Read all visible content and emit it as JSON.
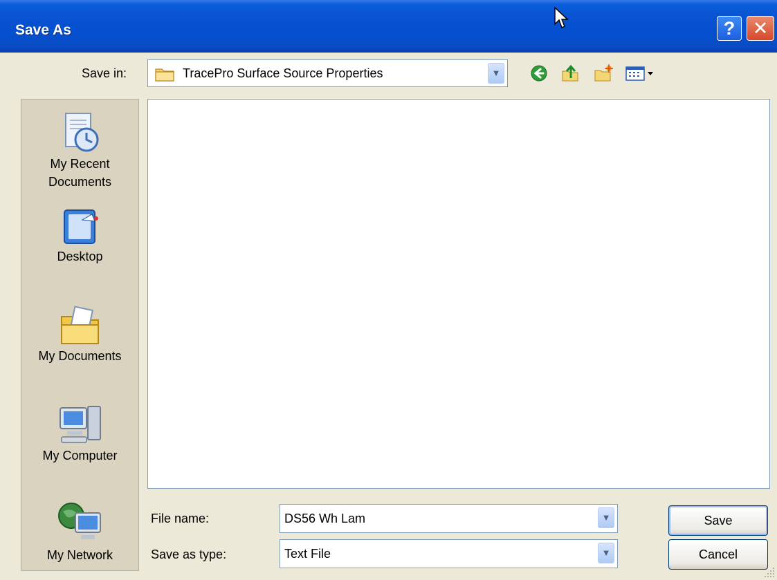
{
  "window": {
    "title": "Save As",
    "help_label": "?",
    "close_label": "✕"
  },
  "toolbar": {
    "save_in_label": "Save in:",
    "save_in_value": "TracePro Surface Source Properties",
    "icons": [
      "back-icon",
      "up-folder-icon",
      "new-folder-icon",
      "views-menu-icon"
    ]
  },
  "places": [
    {
      "label_line1": "My Recent",
      "label_line2": "Documents",
      "icon": "recent-documents-icon"
    },
    {
      "label_line1": "Desktop",
      "label_line2": "",
      "icon": "desktop-icon"
    },
    {
      "label_line1": "My Documents",
      "label_line2": "",
      "icon": "my-documents-icon"
    },
    {
      "label_line1": "My Computer",
      "label_line2": "",
      "icon": "my-computer-icon"
    },
    {
      "label_line1": "My Network",
      "label_line2": "",
      "icon": "my-network-icon"
    }
  ],
  "form": {
    "file_name_label": "File name:",
    "file_name_value": "DS56 Wh Lam",
    "type_label": "Save as type:",
    "type_value": "Text File"
  },
  "buttons": {
    "save": "Save",
    "cancel": "Cancel"
  },
  "colors": {
    "titlebar": "#0450d0",
    "dialog_bg": "#ECE9D8",
    "places_bg": "#d9d3c0",
    "border": "#7f9db9"
  }
}
